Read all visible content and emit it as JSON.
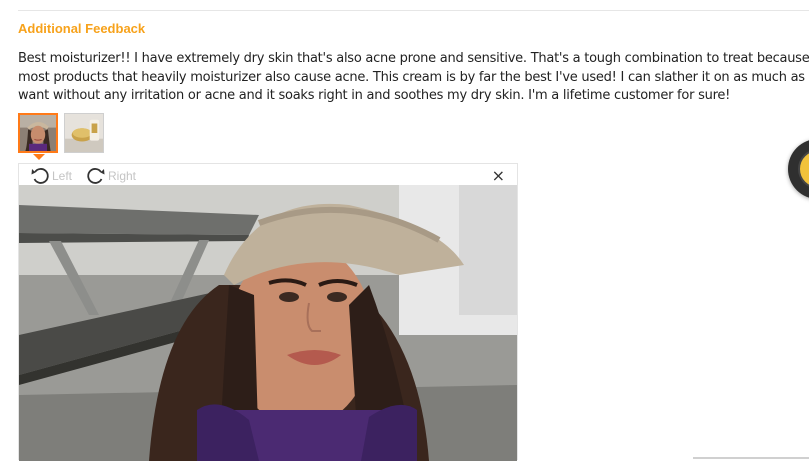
{
  "section": {
    "heading": "Additional Feedback",
    "review_text": "Best moisturizer!! I have extremely dry skin that's also acne prone and sensitive. That's a tough combination to treat because most products that heavily moisturizer also cause acne. This cream is by far the best I've used! I can slather it on as much as I want without any irritation or acne and it soaks right in and soothes my dry skin. I'm a lifetime customer for sure!"
  },
  "thumbnails": [
    {
      "name": "selfie-photo",
      "active": true
    },
    {
      "name": "product-jar-photo",
      "active": false
    }
  ],
  "viewer": {
    "rotate_left_label": "Left",
    "rotate_right_label": "Right",
    "close_label": "×",
    "rotate_left_icon": "rotate-left-icon",
    "rotate_right_icon": "rotate-right-icon",
    "close_icon": "close-icon"
  },
  "colors": {
    "heading": "#f7a21b",
    "active_thumb_border": "#ff7a18",
    "disabled_label": "#c4c4c4"
  }
}
